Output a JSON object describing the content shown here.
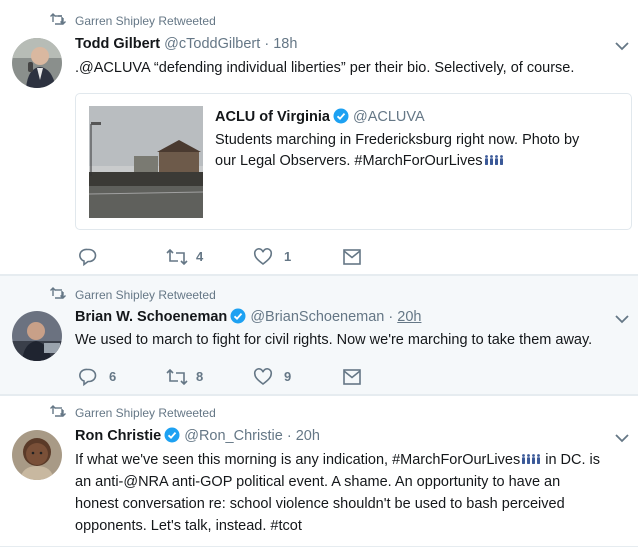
{
  "tweets": [
    {
      "retweeted_by": "Garren Shipley Retweeted",
      "name": "Todd Gilbert",
      "handle": "@cToddGilbert",
      "separator": "·",
      "time": "18h",
      "text": ".@ACLUVA “defending individual liberties” per their bio. Selectively, of course.",
      "quote": {
        "name": "ACLU of Virginia",
        "handle": "@ACLUVA",
        "text_line1": "Students marching in Fredericksburg right now. Photo by",
        "text_line2": "our Legal Observers. #MarchForOurLives"
      },
      "reply_count": "",
      "retweet_count": "4",
      "like_count": "1"
    },
    {
      "retweeted_by": "Garren Shipley Retweeted",
      "name": "Brian W. Schoeneman",
      "handle": "@BrianSchoeneman",
      "separator": "·",
      "time": "20h",
      "text": "We used to march to fight for civil rights. Now we're marching to take them away.",
      "reply_count": "6",
      "retweet_count": "8",
      "like_count": "9"
    },
    {
      "retweeted_by": "Garren Shipley Retweeted",
      "name": "Ron Christie",
      "handle": "@Ron_Christie",
      "separator": "·",
      "time": "20h",
      "text_line1_a": "If what we've seen this morning is any indication, #MarchForOurLives",
      "text_line1_b": " in DC. is",
      "text_line2": "an anti-@NRA anti-GOP political event. A shame. An opportunity to have an",
      "text_line3": "honest conversation re: school violence shouldn't be used to bash perceived",
      "text_line4": "opponents. Let's talk, instead. #tcot"
    }
  ],
  "colors": {
    "verified": "#1da1f2",
    "icon": "#657786",
    "emoji": "#3b5998"
  },
  "icons": [
    "retweet-icon",
    "verified-icon",
    "caret-down-icon",
    "reply-icon",
    "like-icon",
    "message-icon",
    "people-emoji-icon"
  ]
}
